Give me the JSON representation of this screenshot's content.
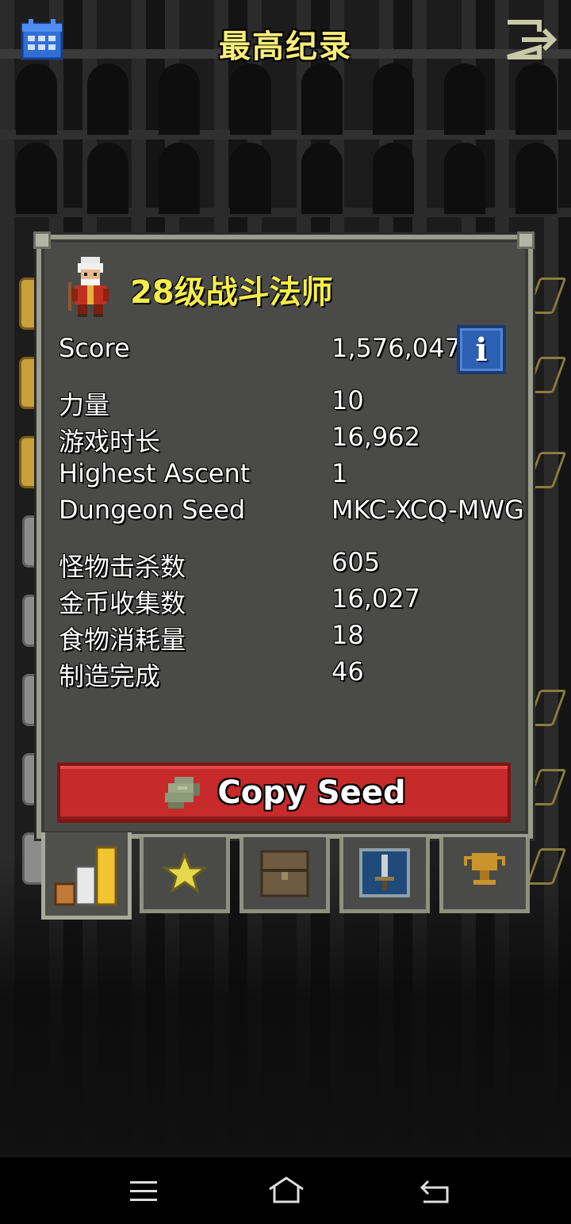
{
  "header": {
    "title": "最高纪录",
    "left_icon": "calendar-icon",
    "right_icon": "exit-icon"
  },
  "hero": {
    "title": "28级战斗法师",
    "icon": "battlemage-portrait"
  },
  "stats": {
    "score": {
      "label": "Score",
      "value": "1,576,047"
    },
    "group1": [
      {
        "label": "力量",
        "value": "10"
      },
      {
        "label": "游戏时长",
        "value": "16,962"
      },
      {
        "label": "Highest Ascent",
        "value": "1"
      },
      {
        "label": "Dungeon Seed",
        "value": "MKC-XCQ-MWG"
      }
    ],
    "group2": [
      {
        "label": "怪物击杀数",
        "value": "605"
      },
      {
        "label": "金币收集数",
        "value": "16,027"
      },
      {
        "label": "食物消耗量",
        "value": "18"
      },
      {
        "label": "制造完成",
        "value": "46"
      }
    ]
  },
  "info_button": {
    "label": "i"
  },
  "copy_button": {
    "label": "Copy Seed",
    "icon": "seed-icon"
  },
  "tabs": [
    {
      "name": "stats",
      "icon": "bar-chart-icon",
      "active": true
    },
    {
      "name": "badges",
      "icon": "star-icon",
      "active": false
    },
    {
      "name": "items",
      "icon": "chest-icon",
      "active": false
    },
    {
      "name": "talents",
      "icon": "sword-icon",
      "active": false
    },
    {
      "name": "achievements",
      "icon": "trophy-icon",
      "active": false
    }
  ],
  "navbar": {
    "icons": [
      "menu-icon",
      "home-icon",
      "back-icon"
    ]
  },
  "colors": {
    "title_yellow": "#f7ed4a",
    "panel_bg": "#4a4b48",
    "panel_border": "#9a9c8c",
    "copy_red": "#c62a2a",
    "info_blue": "#2d5fb3"
  }
}
